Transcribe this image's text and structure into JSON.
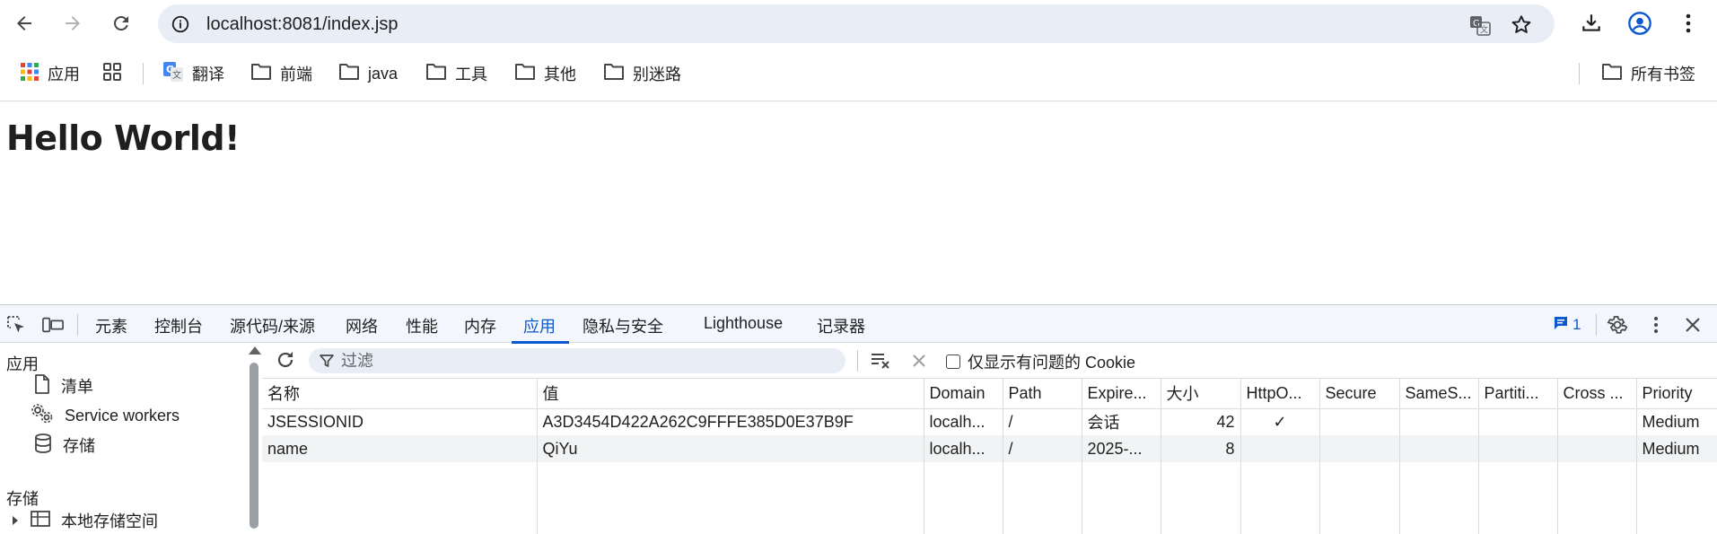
{
  "browser": {
    "url": "localhost:8081/index.jsp",
    "bookmarks": [
      {
        "label": "应用",
        "icon": "apps-grid-icon"
      },
      {
        "label": "",
        "icon": "tab-groups-icon"
      },
      {
        "label": "翻译",
        "icon": "google-translate-icon"
      },
      {
        "label": "前端",
        "icon": "folder-icon"
      },
      {
        "label": "java",
        "icon": "folder-icon"
      },
      {
        "label": "工具",
        "icon": "folder-icon"
      },
      {
        "label": "其他",
        "icon": "folder-icon"
      },
      {
        "label": "别迷路",
        "icon": "folder-icon"
      }
    ],
    "all_bookmarks_label": "所有书签"
  },
  "page": {
    "heading": "Hello World!"
  },
  "devtools": {
    "tabs": [
      "元素",
      "控制台",
      "源代码/来源",
      "网络",
      "性能",
      "内存",
      "应用",
      "隐私与安全",
      "Lighthouse",
      "记录器"
    ],
    "active_tab": "应用",
    "issues_count": "1",
    "sidebar": {
      "section_app": "应用",
      "items": [
        "清单",
        "Service workers",
        "存储"
      ],
      "section_storage": "存储",
      "storage_first_item": "本地存储空间"
    },
    "cookies": {
      "filter_placeholder": "过滤",
      "only_issues_label": "仅显示有问题的 Cookie",
      "columns": [
        "名称",
        "值",
        "Domain",
        "Path",
        "Expire...",
        "大小",
        "HttpO...",
        "Secure",
        "SameS...",
        "Partiti...",
        "Cross ...",
        "Priority"
      ],
      "rows": [
        {
          "name": "JSESSIONID",
          "value": "A3D3454D422A262C9FFFE385D0E37B9F",
          "domain": "localh...",
          "path": "/",
          "expires": "会话",
          "size": "42",
          "httponly": "✓",
          "secure": "",
          "samesite": "",
          "partition": "",
          "cross": "",
          "priority": "Medium"
        },
        {
          "name": "name",
          "value": "QiYu",
          "domain": "localh...",
          "path": "/",
          "expires": "2025-...",
          "size": "8",
          "httponly": "",
          "secure": "",
          "samesite": "",
          "partition": "",
          "cross": "",
          "priority": "Medium"
        }
      ]
    }
  },
  "colors": {
    "accent": "#0b57d0",
    "omnibox_bg": "#e9eef6",
    "devtools_tabbar_bg": "#f3f6fc"
  }
}
